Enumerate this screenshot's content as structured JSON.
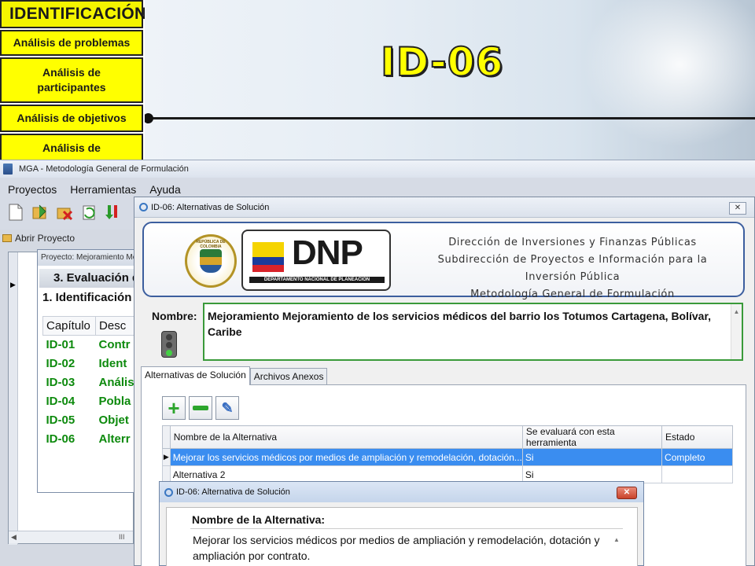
{
  "slide": {
    "nav": {
      "title": "IDENTIFICACIÓN",
      "items": [
        "Análisis de problemas",
        "Análisis de participantes",
        "Análisis de objetivos",
        "Análisis de"
      ]
    },
    "title": "ID-06"
  },
  "app": {
    "window_title": "MGA - Metodología General de Formulación",
    "menu": [
      "Proyectos",
      "Herramientas",
      "Ayuda"
    ],
    "left_panel": {
      "open_project": "Abrir Proyecto",
      "scroll_marker": "III"
    },
    "project_window": {
      "title": "Proyecto: Mejoramiento Me",
      "evaluation": "3. Evaluación d",
      "identification": "1. Identificación",
      "headers": [
        "Capítulo",
        "Desc"
      ],
      "rows": [
        [
          "ID-01",
          "Contr"
        ],
        [
          "ID-02",
          "Ident"
        ],
        [
          "ID-03",
          "Anális"
        ],
        [
          "ID-04",
          "Pobla"
        ],
        [
          "ID-05",
          "Objet"
        ],
        [
          "ID-06",
          "Alterr"
        ]
      ]
    }
  },
  "alt_window": {
    "title": "ID-06: Alternativas de Solución",
    "close_label": "✕",
    "header": {
      "crest_text": "REPÚBLICA DE COLOMBIA",
      "logo_text": "DNP",
      "logo_subtitle": "DEPARTAMENTO NACIONAL DE PLANEACIÓN",
      "lines": [
        "Dirección de Inversiones y Finanzas Públicas",
        "Subdirección de Proyectos e Información para la Inversión Pública",
        "Metodología General de Formulación"
      ]
    },
    "nombre_label": "Nombre:",
    "nombre_value": "Mejoramiento Mejoramiento de los servicios médicos del barrio los Totumos Cartagena, Bolívar, Caribe",
    "tabs": [
      "Alternativas de Solución",
      "Archivos Anexos"
    ],
    "grid": {
      "headers": [
        "Nombre de la Alternativa",
        "Se evaluará con esta herramienta",
        "Estado"
      ],
      "rows": [
        [
          "Mejorar los servicios médicos por medios de ampliación y remodelación, dotación...",
          "Si",
          "Completo"
        ],
        [
          "Alternativa 2",
          "Si",
          ""
        ]
      ]
    }
  },
  "sub_window": {
    "title": "ID-06: Alternativa de Solución",
    "close_label": "✕",
    "label": "Nombre de la Alternativa:",
    "value": "Mejorar los servicios médicos por medios de ampliación y remodelación, dotación y ampliación por contrato."
  },
  "colors": {
    "nav_yellow": "#ffff00",
    "title_yellow": "#ffff00",
    "selected_row": "#3a8df0",
    "chapter_green": "#0d8a0d",
    "border_green": "#3a9a3a"
  },
  "icons": [
    "new-file-icon",
    "open-folder-icon",
    "delete-folder-icon",
    "refresh-icon",
    "import-icon",
    "plus-icon",
    "minus-icon",
    "edit-icon",
    "traffic-light-icon"
  ]
}
